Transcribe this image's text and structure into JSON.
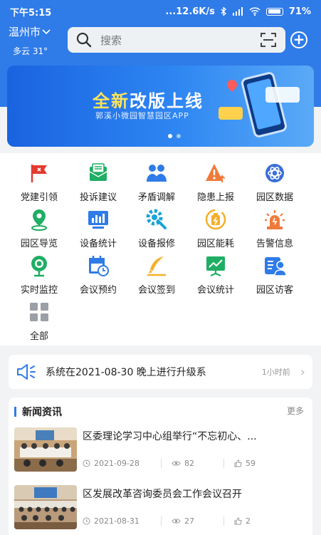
{
  "status_bar": {
    "time": "下午5:15",
    "network_speed": "...12.6K/s",
    "battery": "71"
  },
  "location": {
    "city": "温州市",
    "weather": "多云 31°"
  },
  "search": {
    "placeholder": "搜索"
  },
  "banner": {
    "title_highlight": "全新",
    "title_rest": "改版上线",
    "subtitle": "郭溪小微园智慧园区APP",
    "slide_count": 2,
    "active_slide": 1
  },
  "quick_menu": [
    {
      "label": "党建引领",
      "icon": "party-flag-icon",
      "color": "#e23a2e"
    },
    {
      "label": "投诉建议",
      "icon": "complaint-envelope-icon",
      "color": "#1fae64"
    },
    {
      "label": "矛盾调解",
      "icon": "mediation-people-icon",
      "color": "#2f7be8"
    },
    {
      "label": "隐患上报",
      "icon": "hazard-warning-icon",
      "color": "#f07a3a"
    },
    {
      "label": "园区数据",
      "icon": "park-data-icon",
      "color": "#3a6fd8"
    },
    {
      "label": "园区导览",
      "icon": "map-pin-icon",
      "color": "#1fae64"
    },
    {
      "label": "设备统计",
      "icon": "equipment-chart-icon",
      "color": "#2f7be8"
    },
    {
      "label": "设备报修",
      "icon": "repair-gear-icon",
      "color": "#1aa3d8"
    },
    {
      "label": "园区能耗",
      "icon": "energy-battery-icon",
      "color": "#f2b02a"
    },
    {
      "label": "告警信息",
      "icon": "alarm-light-icon",
      "color": "#f07a3a"
    },
    {
      "label": "实时监控",
      "icon": "camera-icon",
      "color": "#1fae64"
    },
    {
      "label": "会议预约",
      "icon": "calendar-clock-icon",
      "color": "#2f7be8"
    },
    {
      "label": "会议签到",
      "icon": "sign-pen-icon",
      "color": "#f2b02a"
    },
    {
      "label": "会议统计",
      "icon": "meeting-stats-icon",
      "color": "#1fae64"
    },
    {
      "label": "园区访客",
      "icon": "visitor-card-icon",
      "color": "#2f7be8"
    },
    {
      "label": "全部",
      "icon": "all-grid-icon",
      "color": "#9aa0a6"
    }
  ],
  "notice": {
    "text": "系统在2021-08-30 晚上进行升级系",
    "time": "1小时前"
  },
  "news": {
    "title": "新闻资讯",
    "more": "更多",
    "items": [
      {
        "title": "区委理论学习中心组举行“不忘初心、...",
        "date": "2021-09-28",
        "views": "82",
        "likes": "59"
      },
      {
        "title": "区发展改革咨询委员会工作会议召开",
        "date": "2021-08-31",
        "views": "27",
        "likes": "2"
      }
    ]
  },
  "colors": {
    "primary": "#2f7be8",
    "highlight": "#ffe35a",
    "background": "#f2f3f5"
  }
}
